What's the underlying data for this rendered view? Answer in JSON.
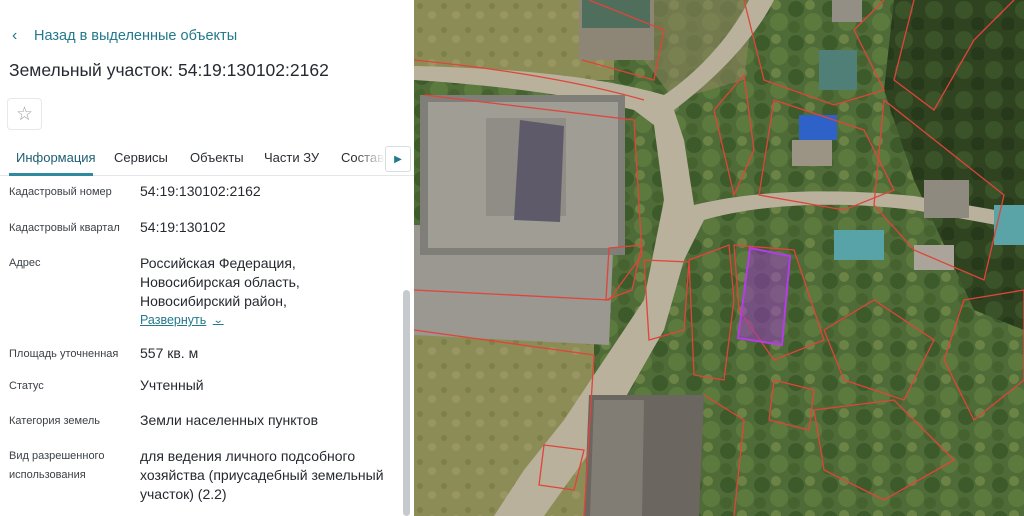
{
  "nav": {
    "back_label": "Назад в выделенные объекты"
  },
  "object": {
    "title": "Земельный участок: 54:19:130102:2162"
  },
  "favorite": {
    "icon": "star-outline-icon"
  },
  "tabs": [
    {
      "label": "Информация",
      "active": true
    },
    {
      "label": "Сервисы",
      "active": false
    },
    {
      "label": "Объекты",
      "active": false
    },
    {
      "label": "Части ЗУ",
      "active": false
    },
    {
      "label": "Состав",
      "active": false
    }
  ],
  "tabs_next_icon": "chevron-right-icon",
  "info": {
    "cadastral_number": {
      "label": "Кадастровый номер",
      "value": "54:19:130102:2162"
    },
    "cadastral_quarter": {
      "label": "Кадастровый квартал",
      "value": "54:19:130102"
    },
    "address": {
      "label": "Адрес",
      "lines": [
        "Российская Федерация,",
        "Новосибирская область,",
        "Новосибирский район,"
      ],
      "expand_label": "Развернуть"
    },
    "area": {
      "label": "Площадь уточненная",
      "value": "557 кв. м"
    },
    "status": {
      "label": "Статус",
      "value": "Учтенный"
    },
    "land_category": {
      "label": "Категория земель",
      "value": "Земли населенных пунктов"
    },
    "permitted_use": {
      "label_lines": [
        "Вид разрешенного",
        "использования"
      ],
      "value_lines": [
        "для ведения личного подсобного",
        "хозяйства (приусадебный земельный",
        "участок) (2.2)"
      ]
    }
  },
  "colors": {
    "accent": "#23798d",
    "parcel_border": "#e0443a",
    "selected_parcel": "#a332d6"
  }
}
